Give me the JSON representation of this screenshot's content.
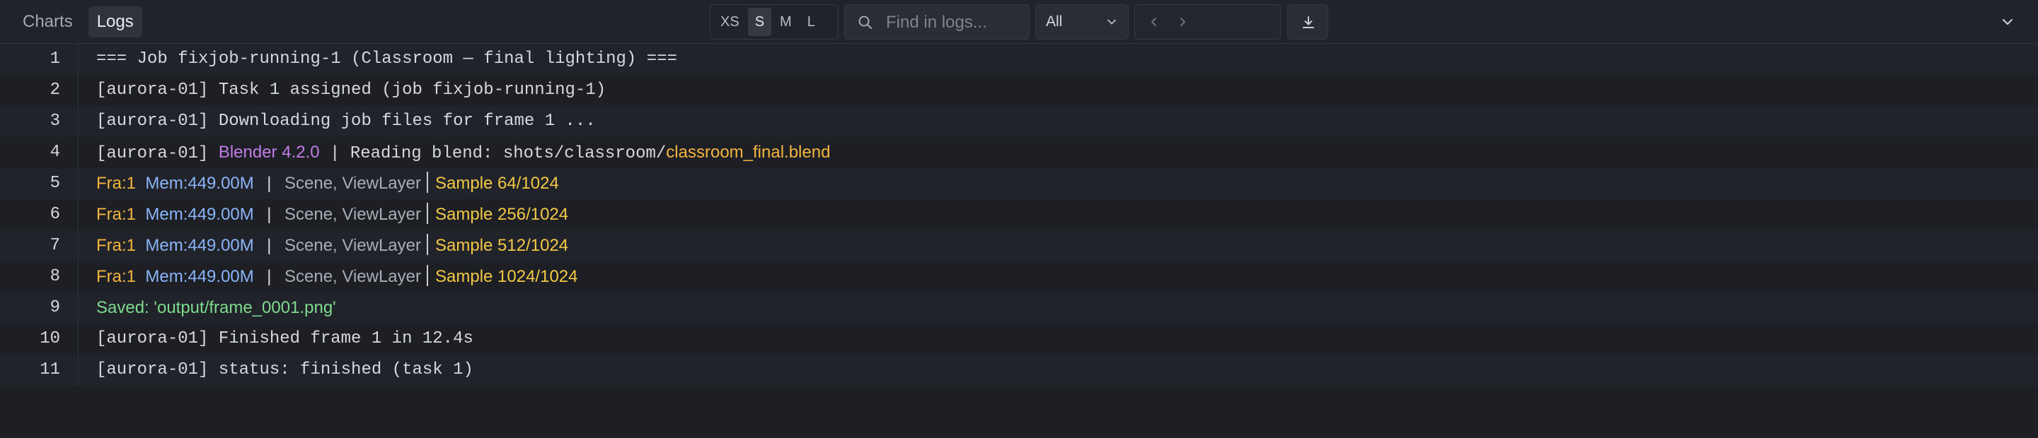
{
  "tabs": [
    {
      "label": "Charts",
      "active": false
    },
    {
      "label": "Logs",
      "active": true
    }
  ],
  "sizes": [
    {
      "label": "XS",
      "active": false
    },
    {
      "label": "S",
      "active": true
    },
    {
      "label": "M",
      "active": false
    },
    {
      "label": "L",
      "active": false
    }
  ],
  "search": {
    "placeholder": "Find in logs...",
    "value": ""
  },
  "filter": {
    "value": "All"
  },
  "icons": {
    "search": "search-icon",
    "filter_chevron": "chevron-down-icon",
    "prev": "chevron-left-icon",
    "next": "chevron-right-icon",
    "download": "download-icon",
    "collapse": "chevron-down-icon"
  },
  "colors": {
    "background": "#1d1f25",
    "row_alt": "#21232a",
    "blender": "#c27ee6",
    "file": "#f4b53f",
    "frame": "#f4b53f",
    "memory": "#8ab4f8",
    "scene": "#a9acb3",
    "sample": "#f3c845",
    "saved": "#7ddb8e"
  },
  "log": {
    "lines": [
      {
        "n": "1",
        "text": "=== Job fixjob-running-1 (Classroom — final lighting) ==="
      },
      {
        "n": "2",
        "text": "[aurora-01] Task 1 assigned (job fixjob-running-1)"
      },
      {
        "n": "3",
        "text": "[aurora-01] Downloading job files for frame 1 ..."
      },
      {
        "n": "4",
        "prefix": "[aurora-01] ",
        "blender": "Blender 4.2.0",
        "middle": " | Reading blend: shots/classroom/",
        "file": "classroom_final.blend"
      },
      {
        "n": "5",
        "frame": "Fra:1",
        "mem": "Mem:449.00M",
        "sep": " | ",
        "scene": "Scene, ViewLayer",
        "sample": "Sample 64/1024"
      },
      {
        "n": "6",
        "frame": "Fra:1",
        "mem": "Mem:449.00M",
        "sep": " | ",
        "scene": "Scene, ViewLayer",
        "sample": "Sample 256/1024"
      },
      {
        "n": "7",
        "frame": "Fra:1",
        "mem": "Mem:449.00M",
        "sep": " | ",
        "scene": "Scene, ViewLayer",
        "sample": "Sample 512/1024"
      },
      {
        "n": "8",
        "frame": "Fra:1",
        "mem": "Mem:449.00M",
        "sep": " | ",
        "scene": "Scene, ViewLayer",
        "sample": "Sample 1024/1024"
      },
      {
        "n": "9",
        "saved": "Saved: 'output/frame_0001.png'"
      },
      {
        "n": "10",
        "text": "[aurora-01] Finished frame 1 in 12.4s"
      },
      {
        "n": "11",
        "text": "[aurora-01] status: finished (task 1)"
      }
    ]
  }
}
